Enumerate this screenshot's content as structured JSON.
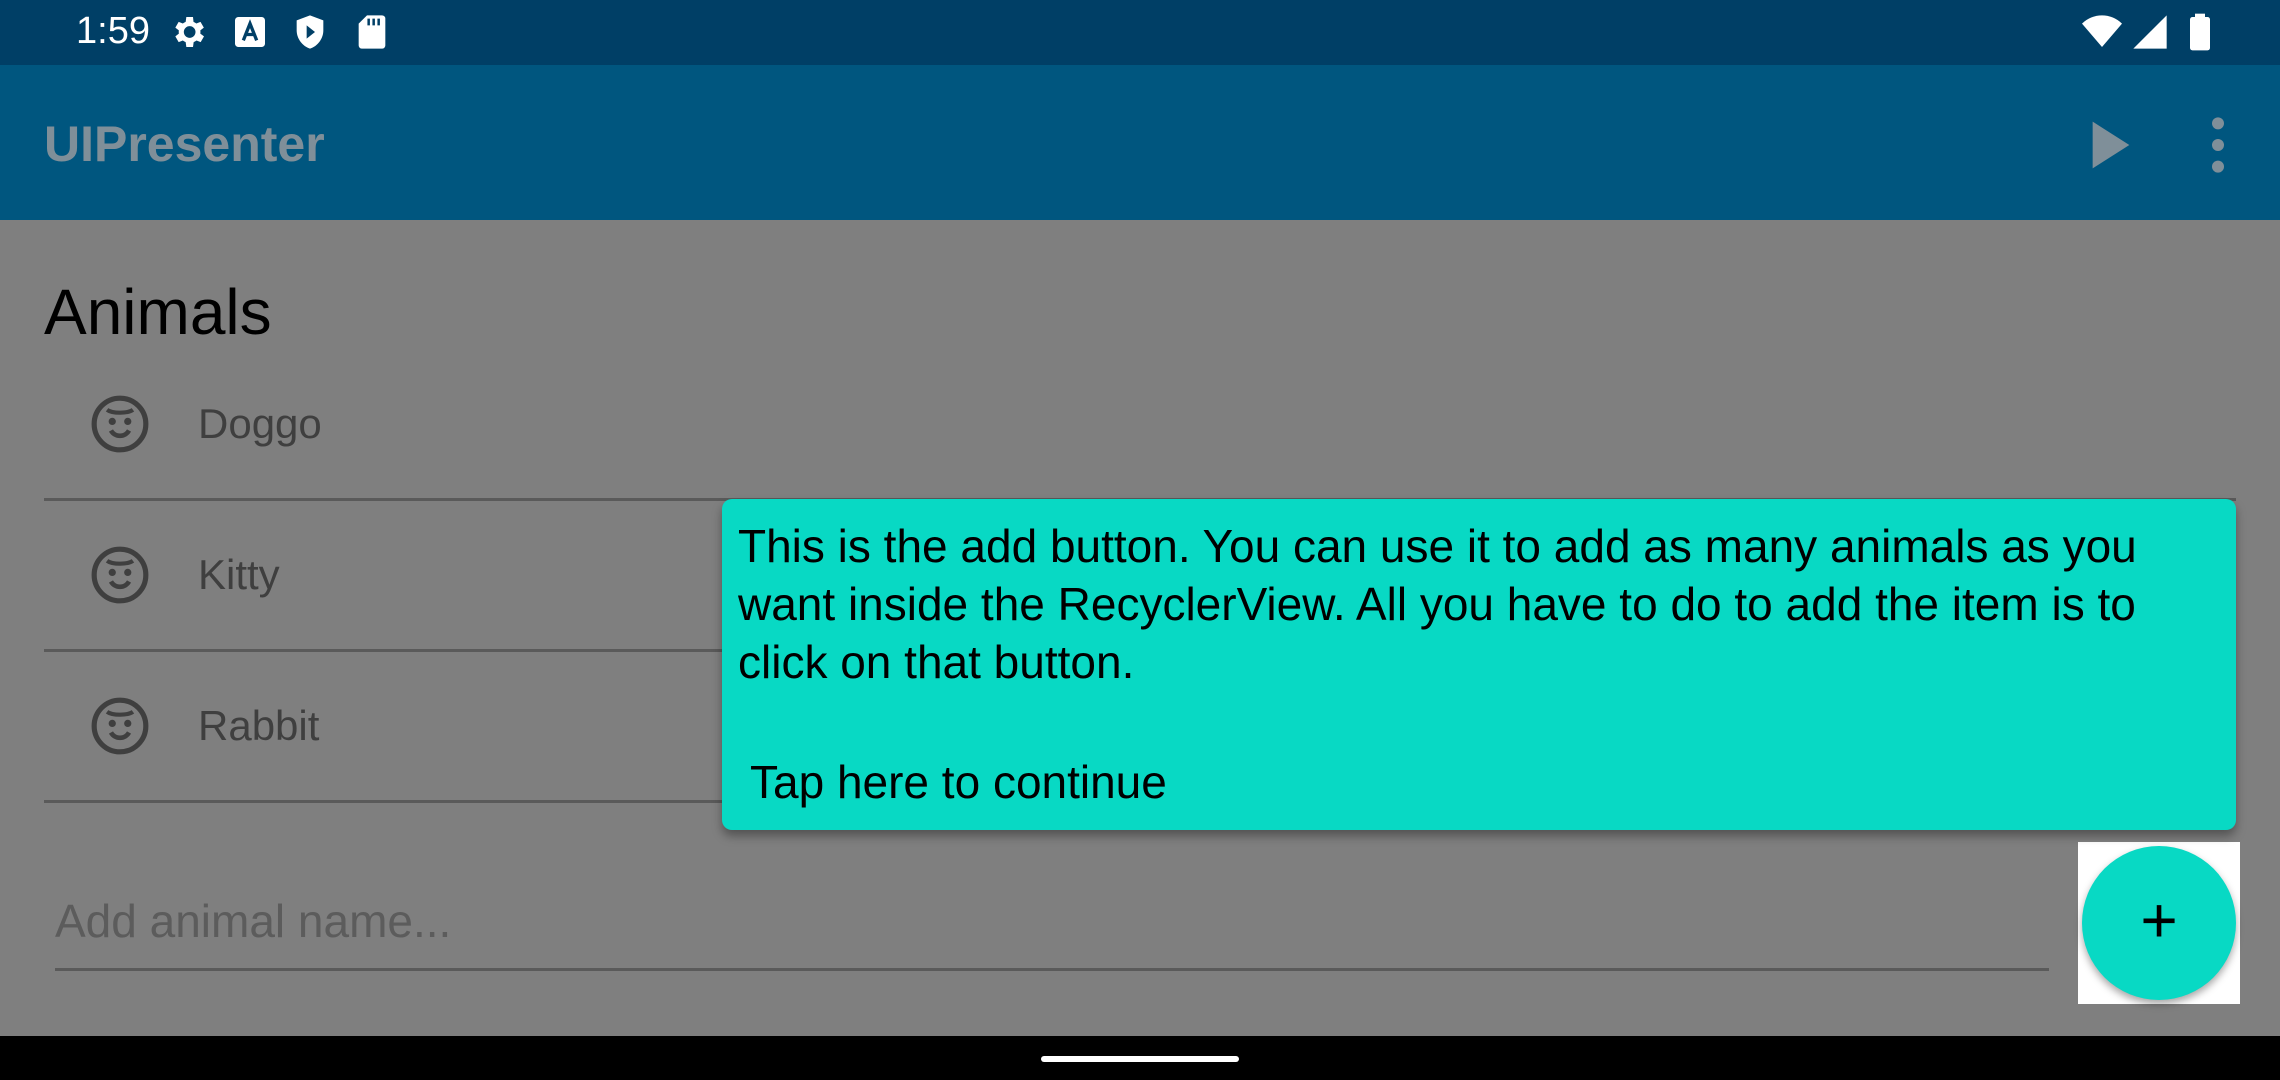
{
  "status_bar": {
    "time": "1:59",
    "icons_left": [
      "settings-icon",
      "text-a-icon",
      "play-protect-icon",
      "sd-card-icon"
    ],
    "icons_right": [
      "wifi-icon",
      "signal-icon",
      "battery-icon"
    ]
  },
  "app_bar": {
    "title": "UIPresenter",
    "actions": [
      "play-icon",
      "more-vert-icon"
    ]
  },
  "section": {
    "title": "Animals"
  },
  "animals": [
    {
      "label": "Doggo",
      "icon": "face-icon"
    },
    {
      "label": "Kitty",
      "icon": "face-icon"
    },
    {
      "label": "Rabbit",
      "icon": "face-icon"
    }
  ],
  "input": {
    "placeholder": "Add animal name...",
    "value": ""
  },
  "fab": {
    "label": "+"
  },
  "tooltip": {
    "text": "This is the add button. You can use it to add as many animals as you want inside the RecyclerView. All you have to do to add the item is to click on that button.",
    "continue": "Tap here to continue"
  },
  "colors": {
    "status_bar": "#003f66",
    "app_bar": "#00567f",
    "accent": "#08d9c4",
    "scrim": "#7f7f7f"
  }
}
